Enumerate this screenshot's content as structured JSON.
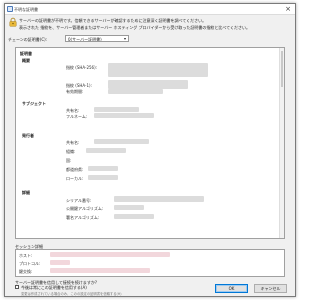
{
  "window": {
    "title": "不明な証明書",
    "close": "×"
  },
  "message": {
    "line1": "サーバーの証明書が不明です。信頼できるサーバーが確認するために注意深く証明書を調べてください。",
    "line2": "表示された 指紋を、サーバー管理者またはサーバー ホスティング プロバイダーから受け取った証明書の指紋と比べてください。"
  },
  "trust": {
    "label": "チェーンの証明書(C):",
    "selected": "0(サーバー証明書)"
  },
  "certificate": {
    "title": "証明書",
    "overview": {
      "heading": "概要",
      "sha256": "指紋 (SHA-256):",
      "sha1": "指紋 (SHA-1):",
      "validity": "有効期間:"
    },
    "subject": {
      "heading": "サブジェクト",
      "common_name": "共有名:",
      "full_name": "フルネーム:"
    },
    "issuer": {
      "heading": "発行者",
      "common_name": "共有名:",
      "org": "組織:",
      "country": "国:",
      "state": "都道府県:",
      "locality": "ローカル:"
    },
    "details": {
      "heading": "詳細",
      "serial": "シリアル番号:",
      "public_key": "公開鍵アルゴリズム:",
      "signature": "署名アルゴリズム:"
    }
  },
  "session": {
    "label": "セッション詳細",
    "host": "ホスト:",
    "protocol": "プロトコル:",
    "key_exchange": "鍵交換:"
  },
  "trust_question": "サーバー証明書を信用して接続を続けますか?",
  "remember": {
    "label": "今後は常にこの証明書を信用する(A)",
    "note": "変更は作成されている場合のみ、このの設定の証明書を信頼する(H)"
  },
  "buttons": {
    "ok": "OK",
    "cancel": "キャンセル"
  },
  "colors": {
    "pink_highlight": "#f2d7dc",
    "blur": "#dcdcdc"
  }
}
